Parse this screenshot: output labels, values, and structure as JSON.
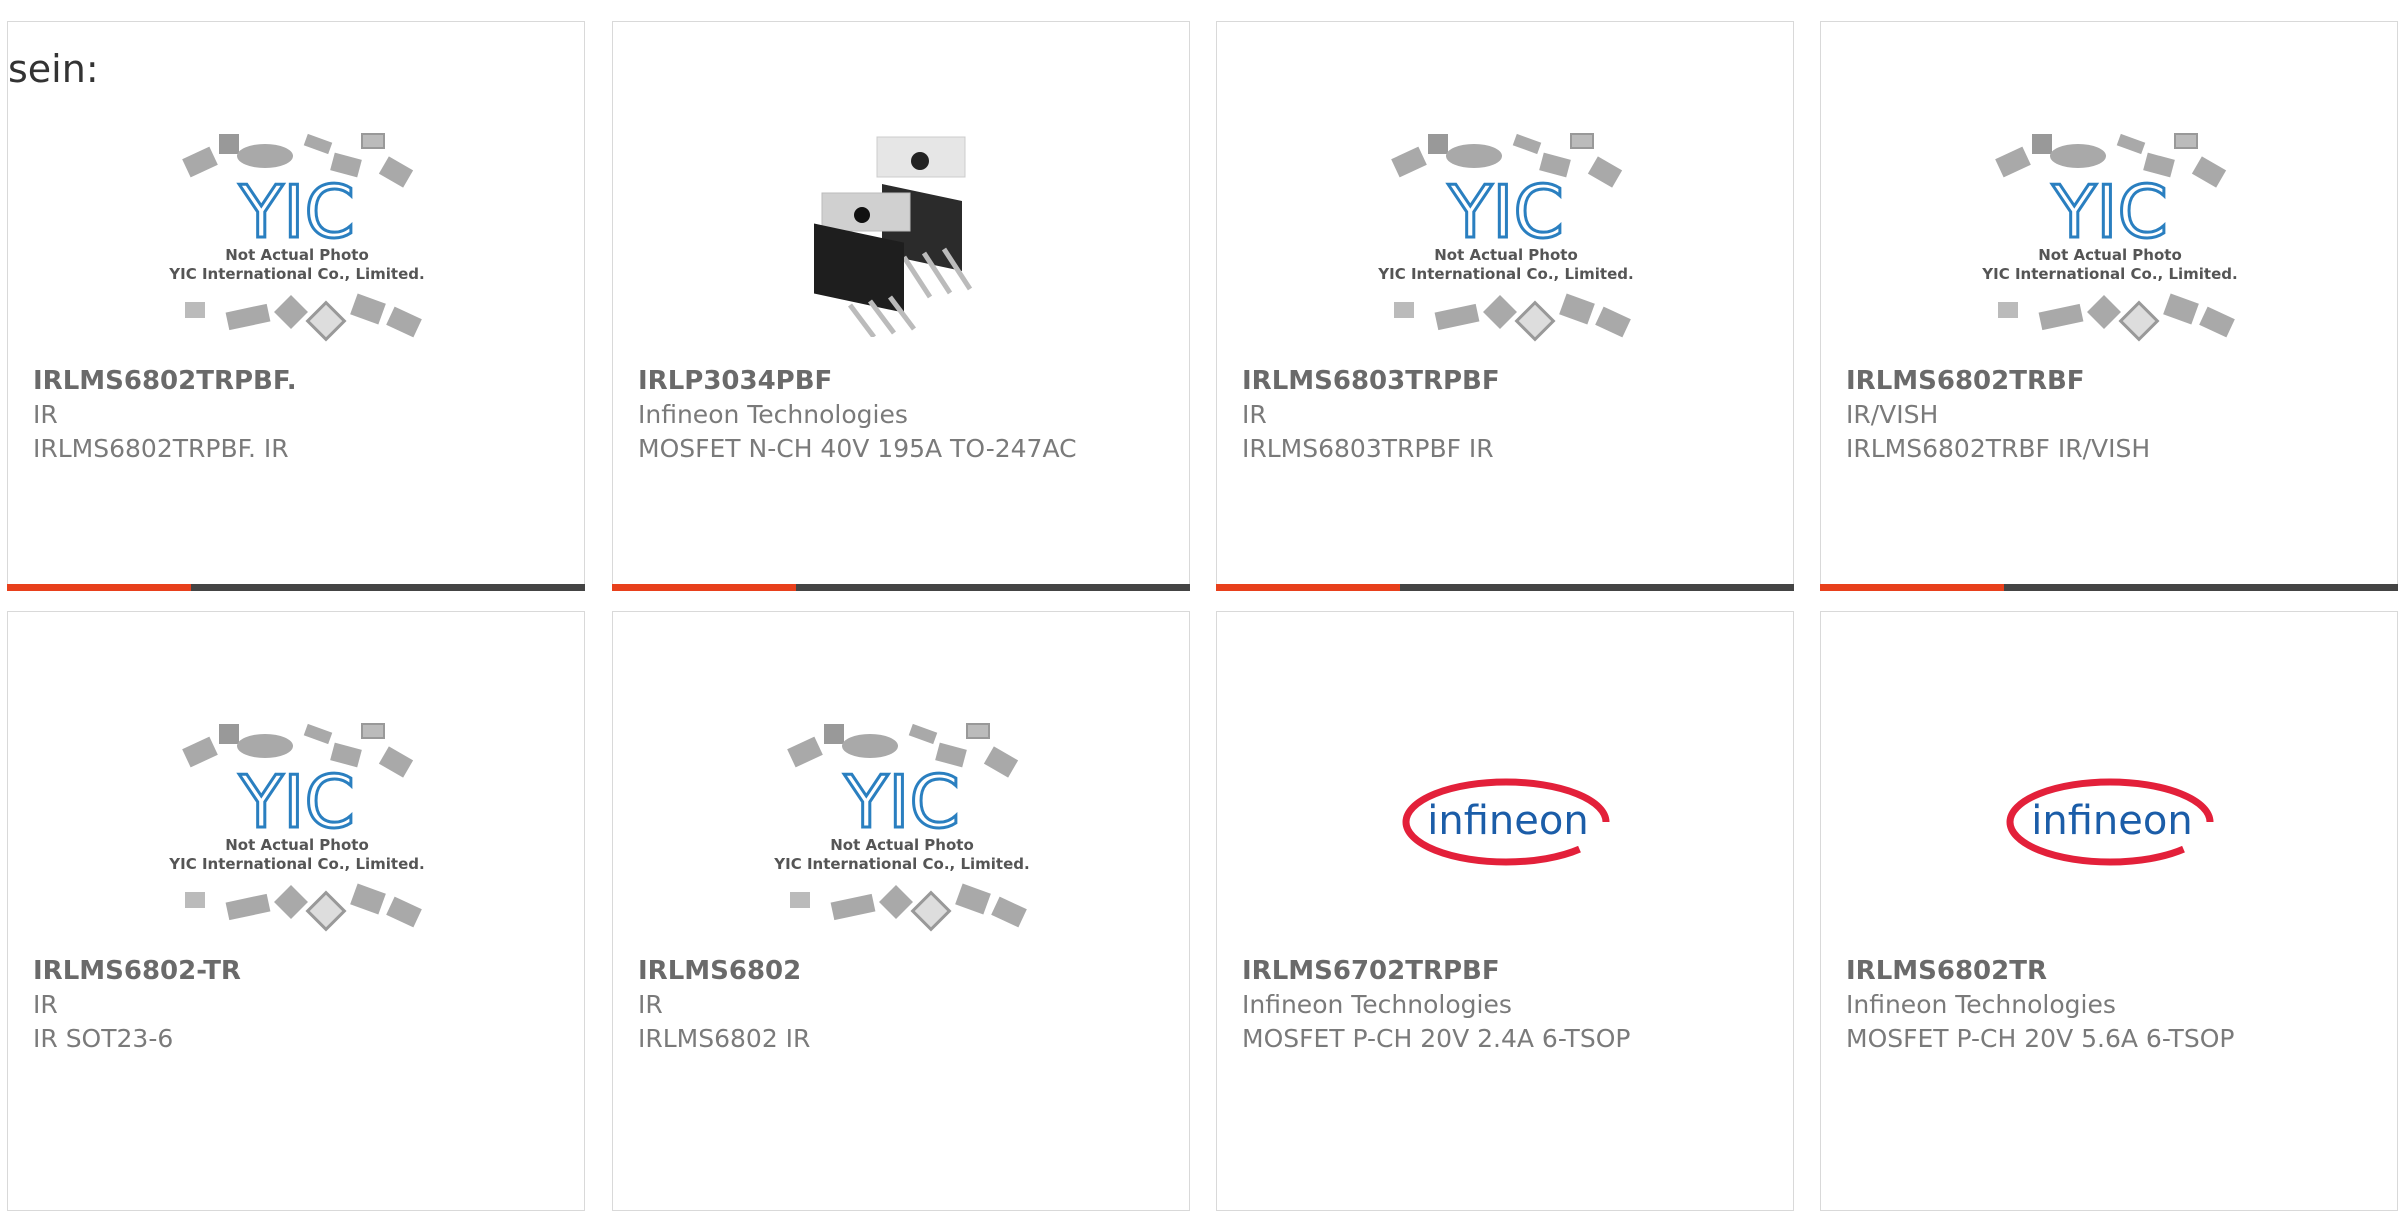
{
  "intro_text": "sein:",
  "placeholder": {
    "line1": "Not Actual Photo",
    "line2": "YIC International Co., Limited.",
    "logo": "YIC"
  },
  "brand_logo_text": "infineon",
  "colors": {
    "accent": "#e8401c",
    "bar": "#444444",
    "yic_blue": "#2a7fc0",
    "infineon_blue": "#1b5da8",
    "infineon_red": "#e3203a"
  },
  "products": [
    {
      "part": "IRLMS6802TRPBF.",
      "mfr": "IR",
      "desc": "IRLMS6802TRPBF. IR",
      "image": "yic-placeholder"
    },
    {
      "part": "IRLP3034PBF",
      "mfr": "Infineon Technologies",
      "desc": "MOSFET N-CH 40V 195A TO-247AC",
      "image": "to247-photo"
    },
    {
      "part": "IRLMS6803TRPBF",
      "mfr": "IR",
      "desc": "IRLMS6803TRPBF IR",
      "image": "yic-placeholder"
    },
    {
      "part": "IRLMS6802TRBF",
      "mfr": "IR/VISH",
      "desc": "IRLMS6802TRBF IR/VISH",
      "image": "yic-placeholder"
    },
    {
      "part": "IRLMS6802-TR",
      "mfr": "IR",
      "desc": "IR SOT23-6",
      "image": "yic-placeholder"
    },
    {
      "part": "IRLMS6802",
      "mfr": "IR",
      "desc": "IRLMS6802 IR",
      "image": "yic-placeholder"
    },
    {
      "part": "IRLMS6702TRPBF",
      "mfr": "Infineon Technologies",
      "desc": "MOSFET P-CH 20V 2.4A 6-TSOP",
      "image": "infineon-logo"
    },
    {
      "part": "IRLMS6802TR",
      "mfr": "Infineon Technologies",
      "desc": "MOSFET P-CH 20V 5.6A 6-TSOP",
      "image": "infineon-logo"
    }
  ]
}
